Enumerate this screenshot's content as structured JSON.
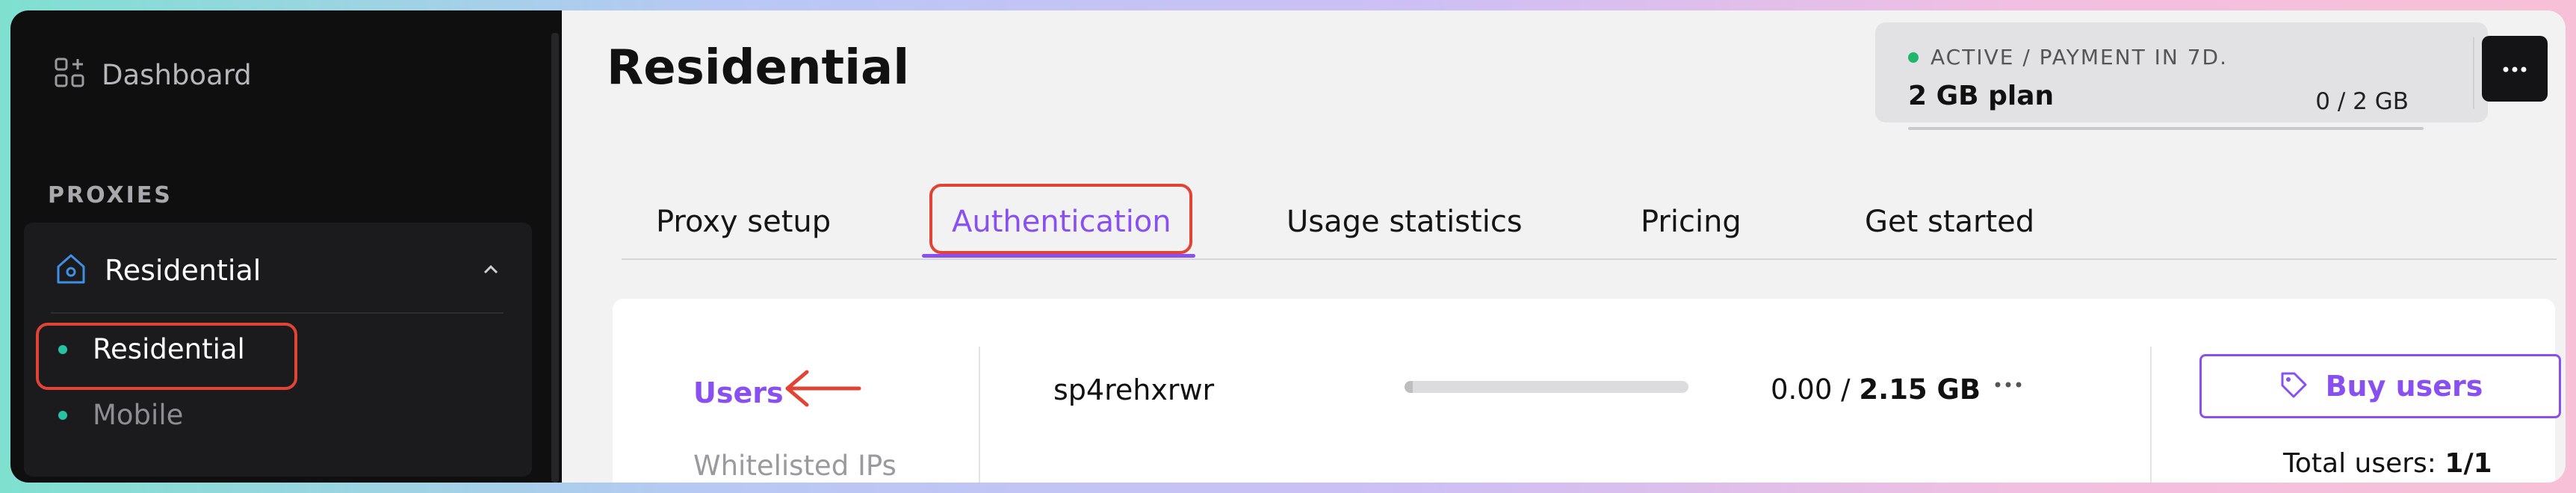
{
  "sidebar": {
    "dashboard_label": "Dashboard",
    "section_label": "PROXIES",
    "group_label": "Residential",
    "items": [
      {
        "label": "Residential",
        "active": true
      },
      {
        "label": "Mobile",
        "active": false
      }
    ]
  },
  "header": {
    "title": "Residential",
    "plan": {
      "status": "ACTIVE / PAYMENT IN 7D.",
      "name": "2 GB plan",
      "usage": "0 / 2 GB"
    }
  },
  "tabs": [
    {
      "label": "Proxy setup",
      "active": false
    },
    {
      "label": "Authentication",
      "active": true
    },
    {
      "label": "Usage statistics",
      "active": false
    },
    {
      "label": "Pricing",
      "active": false
    },
    {
      "label": "Get started",
      "active": false
    }
  ],
  "panel": {
    "nav": {
      "users": "Users",
      "whitelisted": "Whitelisted IPs"
    },
    "user_row": {
      "username": "sp4rehxrwr",
      "used": "0.00 /",
      "limit": "2.15 GB",
      "progress": 0.0
    },
    "buy_users_label": "Buy users",
    "total_users_label": "Total users:",
    "total_users_value": "1/1"
  },
  "colors": {
    "accent": "#8a4ff0",
    "highlight": "#e14335",
    "status_active": "#1fb56b",
    "sidebar_dot": "#27c2a0"
  }
}
